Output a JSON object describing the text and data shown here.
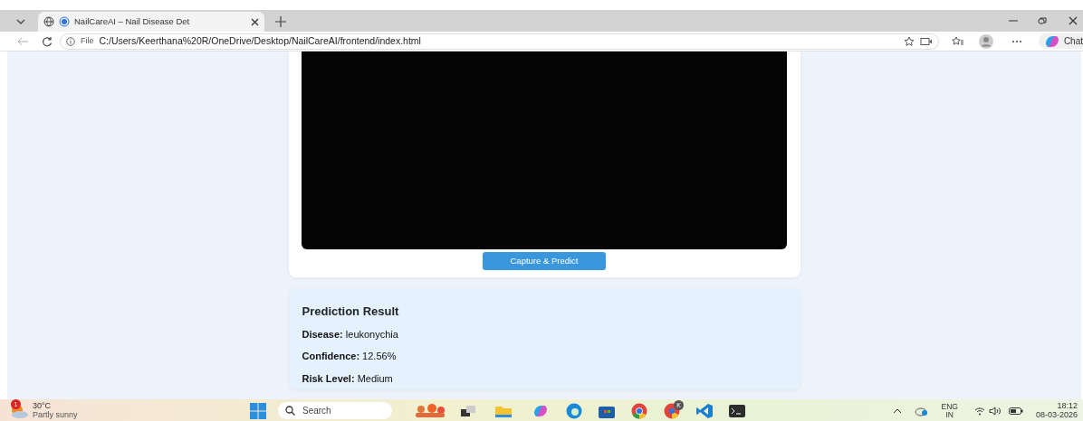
{
  "browser": {
    "tab": {
      "title": "NailCareAI – Nail Disease Det",
      "selected": true
    },
    "address": {
      "scheme": "File",
      "url": "C:/Users/Keerthana%20R/OneDrive/Desktop/NailCareAI/frontend/index.html"
    },
    "copilot_label": "Chat"
  },
  "camera_card": {
    "button": "Capture & Predict"
  },
  "result_card": {
    "title": "Prediction Result",
    "lines": [
      "**Disease:** leukonychia",
      "**Confidence:** 12.56%",
      "**Risk Level:** Medium"
    ]
  },
  "taskbar": {
    "weather": {
      "badge": "1",
      "temperature": "30°C",
      "condition": "Partly sunny"
    },
    "search": {
      "placeholder": "Search"
    },
    "chrome_badge": "K",
    "language": [
      "ENG",
      "IN"
    ],
    "time": "18:12",
    "date": "08-03-2026"
  }
}
